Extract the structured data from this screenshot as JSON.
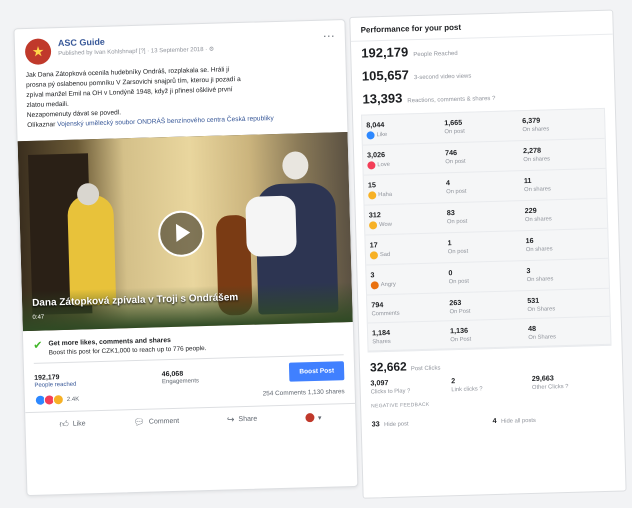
{
  "post": {
    "page_name": "ASC Guide",
    "meta": "Published by Ivan Kohlshnapf [?] · 13 September 2018 · ⚙",
    "text_lines": [
      "Jak Dana Zátopková ocenila hudebníky Ondráš, rozplakala se. Hráli jí",
      "prosna pý oslabenou pomníku V Zarsovichi snajprů tím, kterou ji pozadí a",
      "zpíval manžel Emil na OH v Londýně 1948, když ji přinesl ošklivé první",
      "zlatou medaili.",
      "Nezapomenuty dávat se povedl."
    ],
    "link_prefix": "Olíkaznar",
    "link_text": "Vojenský umělecký soubor ONDRÁŠ benzínového centra Česká republiky",
    "video_title": "Dana Zátopková zpívala v Troji s Ondrášem",
    "video_duration": "0:47",
    "boost_title": "Get more likes, comments and shares",
    "boost_sub": "Boost this post for CZK1,000 to reach up to 776 people.",
    "people_reached": "192,179",
    "people_reached_label": "People reached",
    "engagements": "46,068",
    "engagements_label": "Engagements",
    "boost_button": "Boost Post",
    "reactions_count": "2.4K",
    "comments_shares": "254 Comments  1,130 shares",
    "actions": {
      "like": "Like",
      "comment": "Comment",
      "share": "Share"
    }
  },
  "performance": {
    "title": "Performance for your post",
    "stats": [
      {
        "value": "192,179",
        "label": "People Reached"
      },
      {
        "value": "105,657",
        "label": "3-second video views"
      },
      {
        "value": "13,393",
        "label": "Reactions, comments & shares ?"
      }
    ],
    "grid": [
      [
        {
          "n": "8,044",
          "l": "Like",
          "emo": "like"
        },
        {
          "n": "1,665",
          "l": "On post"
        },
        {
          "n": "6,379",
          "l": "On shares"
        }
      ],
      [
        {
          "n": "3,026",
          "l": "Love",
          "emo": "love"
        },
        {
          "n": "746",
          "l": "On post"
        },
        {
          "n": "2,278",
          "l": "On shares"
        }
      ],
      [
        {
          "n": "15",
          "l": "Haha",
          "emo": "haha"
        },
        {
          "n": "4",
          "l": "On post"
        },
        {
          "n": "11",
          "l": "On shares"
        }
      ],
      [
        {
          "n": "312",
          "l": "Wow",
          "emo": "wow"
        },
        {
          "n": "83",
          "l": "On post"
        },
        {
          "n": "229",
          "l": "On shares"
        }
      ],
      [
        {
          "n": "17",
          "l": "Sad",
          "emo": "sad"
        },
        {
          "n": "1",
          "l": "On post"
        },
        {
          "n": "16",
          "l": "On shares"
        }
      ],
      [
        {
          "n": "3",
          "l": "Angry",
          "emo": "angry"
        },
        {
          "n": "0",
          "l": "On post"
        },
        {
          "n": "3",
          "l": "On shares"
        }
      ],
      [
        {
          "n": "794",
          "l": "Comments"
        },
        {
          "n": "263",
          "l": "On Post"
        },
        {
          "n": "531",
          "l": "On Shares"
        }
      ],
      [
        {
          "n": "1,184",
          "l": "Shares"
        },
        {
          "n": "1,136",
          "l": "On Post"
        },
        {
          "n": "48",
          "l": "On Shares"
        }
      ]
    ],
    "post_clicks": "32,662",
    "post_clicks_label": "Post Clicks",
    "clicks": [
      {
        "n": "3,097",
        "l": "Clicks to Play ?"
      },
      {
        "n": "2",
        "l": "Link clicks ?"
      },
      {
        "n": "29,663",
        "l": "Other Clicks ?"
      }
    ],
    "negative_header": "NEGATIVE FEEDBACK",
    "negative": [
      {
        "n": "33",
        "l": "Hide post"
      },
      {
        "n": "4",
        "l": "Hide all posts"
      }
    ]
  },
  "colors": {
    "link": "#385898",
    "boost": "#4080ff",
    "like": "#2d88ff",
    "love": "#f33e58",
    "haha": "#f7b125",
    "wow": "#f7b125",
    "sad": "#f7b125",
    "angry": "#e9710f"
  }
}
